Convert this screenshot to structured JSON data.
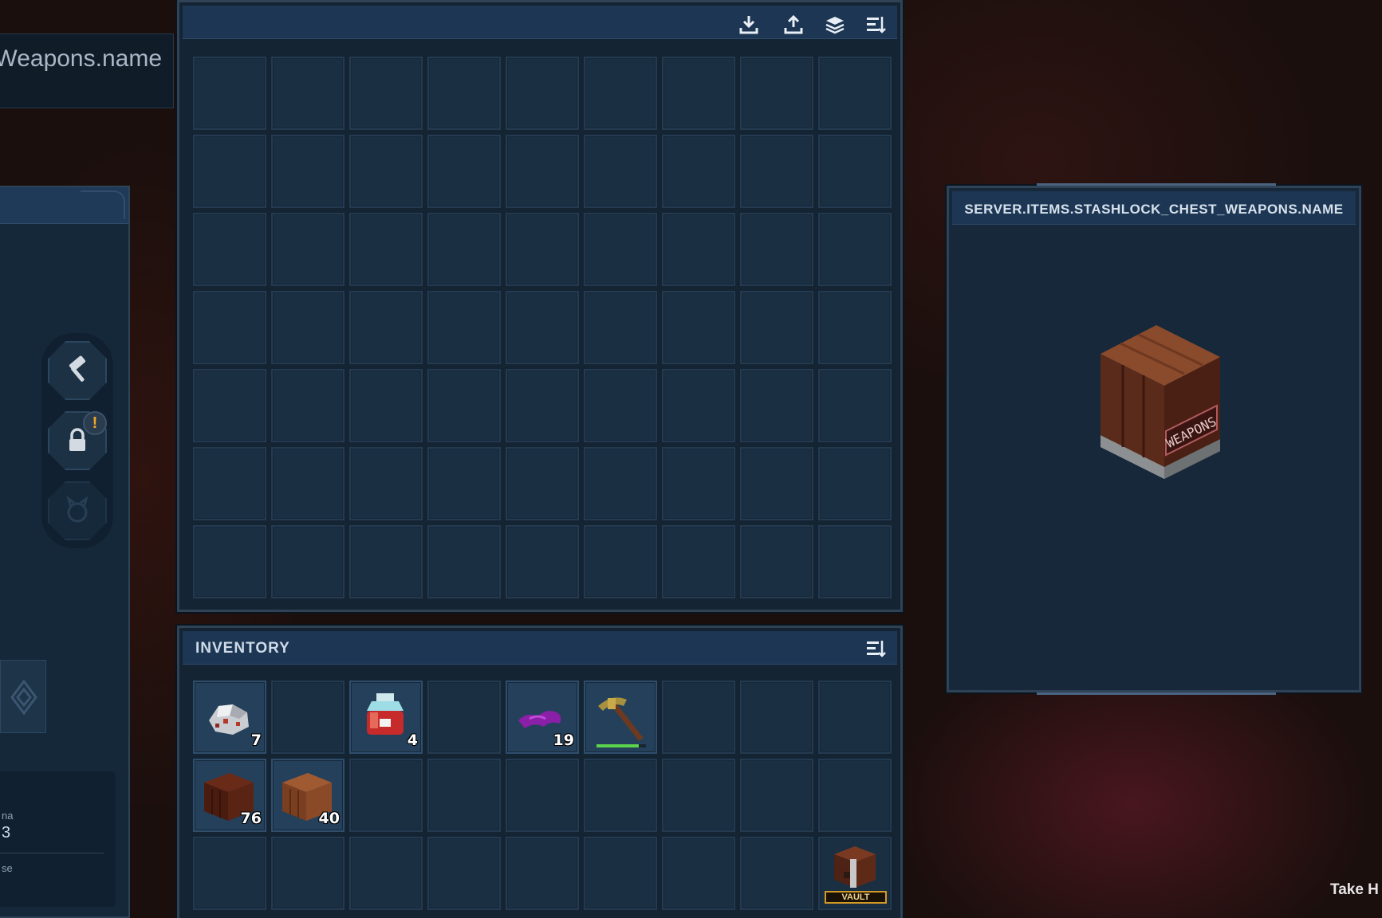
{
  "left_panel": {
    "title_partial": "Weapons.name",
    "info_name_partial": "na",
    "info_value_partial": "3",
    "info_bottom_partial": "se",
    "tools": [
      {
        "icon": "hammer-icon"
      },
      {
        "icon": "lock-icon",
        "alert": "!"
      },
      {
        "icon": "creature-icon"
      }
    ]
  },
  "chest": {
    "toolbar": [
      {
        "icon": "download-icon"
      },
      {
        "icon": "upload-icon"
      },
      {
        "icon": "stack-icon"
      },
      {
        "icon": "sort-icon"
      }
    ],
    "rows": 7,
    "cols": 9
  },
  "inventory": {
    "title": "INVENTORY",
    "sort_icon": "sort-icon",
    "slots": [
      {
        "index": 0,
        "item": "ore-chunk",
        "count": "7"
      },
      {
        "index": 2,
        "item": "potion-jar",
        "count": "4"
      },
      {
        "index": 4,
        "item": "purple-petals",
        "count": "19"
      },
      {
        "index": 5,
        "item": "pickaxe",
        "durability": 0.85
      },
      {
        "index": 9,
        "item": "dark-wood-block",
        "count": "76"
      },
      {
        "index": 10,
        "item": "wood-block",
        "count": "40"
      },
      {
        "index": 26,
        "item": "vault-chest",
        "label": "VAULT"
      }
    ],
    "rows": 3,
    "cols": 9
  },
  "preview": {
    "title": "SERVER.ITEMS.STASHLOCK_CHEST_WEAPONS.NAME",
    "crate_label": "WEAPONS"
  },
  "hint": {
    "text": "Take H"
  }
}
